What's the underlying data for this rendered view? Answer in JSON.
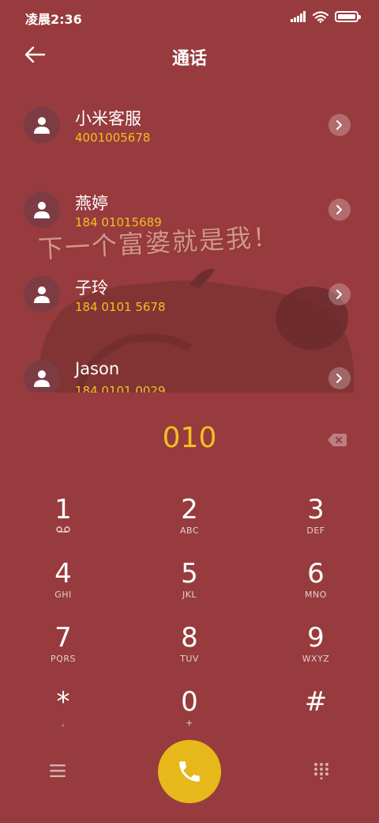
{
  "status_bar": {
    "time": "凌晨2:36",
    "icons": [
      "signal-icon",
      "wifi-icon",
      "battery-icon"
    ],
    "battery_level": 1.0
  },
  "header": {
    "title": "通话",
    "back_icon": "back-arrow-icon"
  },
  "contacts": [
    {
      "name": "小米客服",
      "number": "4001005678"
    },
    {
      "name": "燕婷",
      "number": "184 01015689"
    },
    {
      "name": "子玲",
      "number": "184 0101 5678"
    },
    {
      "name": "Jason",
      "number": "184 0101 0029"
    }
  ],
  "decoration": {
    "text": "下一个富婆就是我！"
  },
  "dialer": {
    "number": "010",
    "delete_icon": "backspace-icon"
  },
  "keypad": [
    {
      "digit": "1",
      "sub": ""
    },
    {
      "digit": "2",
      "sub": "ABC"
    },
    {
      "digit": "3",
      "sub": "DEF"
    },
    {
      "digit": "4",
      "sub": "GHI"
    },
    {
      "digit": "5",
      "sub": "JKL"
    },
    {
      "digit": "6",
      "sub": "MNO"
    },
    {
      "digit": "7",
      "sub": "PQRS"
    },
    {
      "digit": "8",
      "sub": "TUV"
    },
    {
      "digit": "9",
      "sub": "WXYZ"
    },
    {
      "digit": "*",
      "sub": ","
    },
    {
      "digit": "0",
      "sub": "+"
    },
    {
      "digit": "#",
      "sub": ""
    }
  ],
  "bottom_bar": {
    "menu_icon": "menu-icon",
    "call_icon": "phone-icon",
    "keypad_icon": "dialpad-icon"
  },
  "colors": {
    "background": "#983b3e",
    "accent_yellow": "#f0c020",
    "call_button": "#e6b81a"
  }
}
